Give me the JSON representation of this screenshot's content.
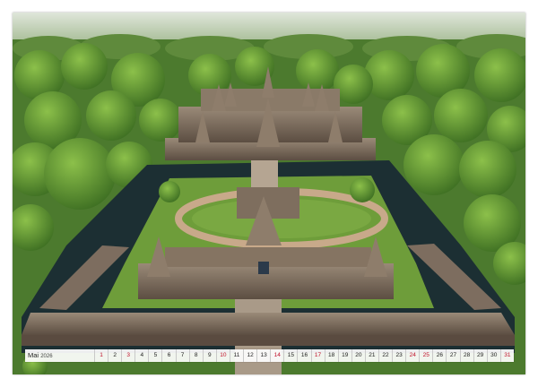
{
  "calendar": {
    "month": "Mai",
    "year": "2026",
    "days": [
      {
        "n": "1",
        "red": true
      },
      {
        "n": "2",
        "red": false
      },
      {
        "n": "3",
        "red": true
      },
      {
        "n": "4",
        "red": false
      },
      {
        "n": "5",
        "red": false
      },
      {
        "n": "6",
        "red": false
      },
      {
        "n": "7",
        "red": false
      },
      {
        "n": "8",
        "red": false
      },
      {
        "n": "9",
        "red": false
      },
      {
        "n": "10",
        "red": true
      },
      {
        "n": "11",
        "red": false
      },
      {
        "n": "12",
        "red": false
      },
      {
        "n": "13",
        "red": false
      },
      {
        "n": "14",
        "red": true
      },
      {
        "n": "15",
        "red": false
      },
      {
        "n": "16",
        "red": false
      },
      {
        "n": "17",
        "red": true
      },
      {
        "n": "18",
        "red": false
      },
      {
        "n": "19",
        "red": false
      },
      {
        "n": "20",
        "red": false
      },
      {
        "n": "21",
        "red": false
      },
      {
        "n": "22",
        "red": false
      },
      {
        "n": "23",
        "red": false
      },
      {
        "n": "24",
        "red": true
      },
      {
        "n": "25",
        "red": true
      },
      {
        "n": "26",
        "red": false
      },
      {
        "n": "27",
        "red": false
      },
      {
        "n": "28",
        "red": false
      },
      {
        "n": "29",
        "red": false
      },
      {
        "n": "30",
        "red": false
      },
      {
        "n": "31",
        "red": true
      }
    ]
  },
  "colors": {
    "holiday": "#c0102a",
    "forest": "#3f6b2a",
    "moat": "#1c2f33",
    "stone": "#7a6a5c"
  }
}
